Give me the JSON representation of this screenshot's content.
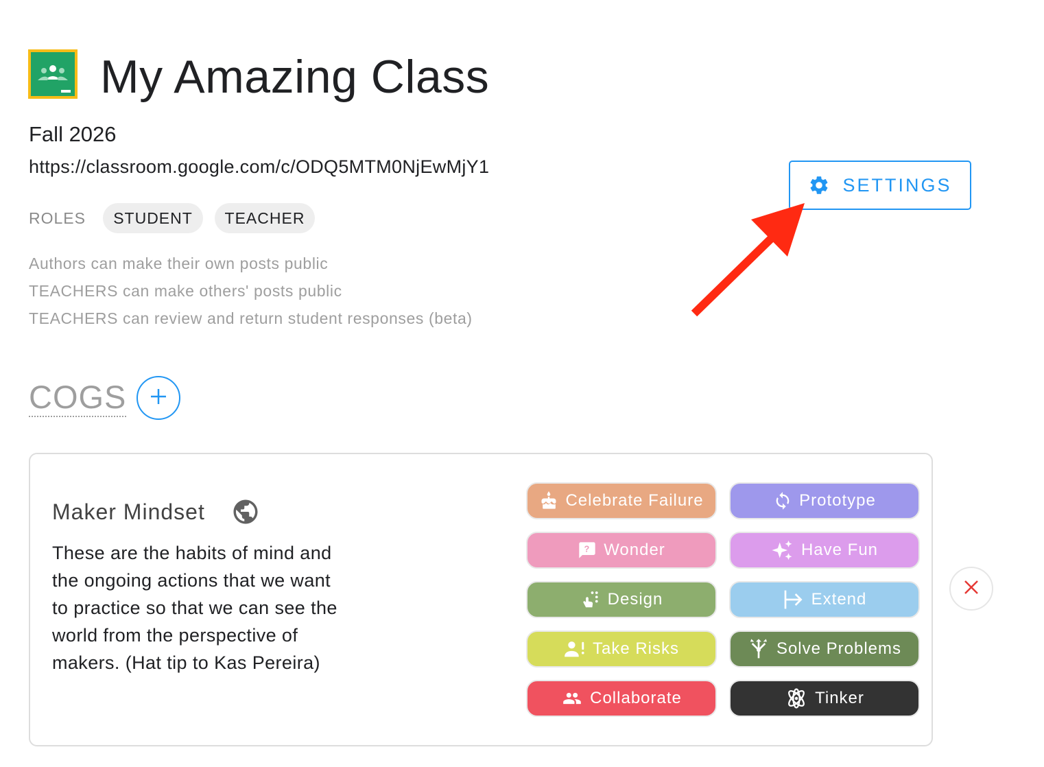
{
  "header": {
    "title": "My Amazing Class",
    "term": "Fall 2026",
    "url": "https://classroom.google.com/c/ODQ5MTM0NjEwMjY1",
    "logo_icon": "google-classroom-icon"
  },
  "roles": {
    "label": "ROLES",
    "items": [
      "STUDENT",
      "TEACHER"
    ]
  },
  "permissions": [
    "Authors can make their own posts public",
    "TEACHERS can make others' posts public",
    "TEACHERS can review and return student responses (beta)"
  ],
  "settings_button": {
    "label": "SETTINGS",
    "icon": "gear-icon",
    "color": "#2196f3"
  },
  "annotation": {
    "arrow_color": "#ff2a12"
  },
  "cogs": {
    "title": "COGS",
    "add_icon": "plus-icon",
    "card": {
      "title": "Maker Mindset",
      "visibility_icon": "globe-icon",
      "description": "These are the habits of mind and the ongoing actions that we want to practice so that we can see the world from the perspective of makers. (Hat tip to Kas Pereira)",
      "remove_icon": "close-icon",
      "tags": [
        {
          "label": "Celebrate Failure",
          "icon": "cake-icon",
          "color": "#e8a882"
        },
        {
          "label": "Prototype",
          "icon": "sync-icon",
          "color": "#9e98ec"
        },
        {
          "label": "Wonder",
          "icon": "question-bubble-icon",
          "color": "#ef9bbd"
        },
        {
          "label": "Have Fun",
          "icon": "sparkle-icon",
          "color": "#dc9cec"
        },
        {
          "label": "Design",
          "icon": "pointer-hand-icon",
          "color": "#8dae6e"
        },
        {
          "label": "Extend",
          "icon": "arrow-bar-right-icon",
          "color": "#9bcdee"
        },
        {
          "label": "Take Risks",
          "icon": "person-exclamation-icon",
          "color": "#d6dc5a"
        },
        {
          "label": "Solve Problems",
          "icon": "arrows-split-icon",
          "color": "#6d8a56"
        },
        {
          "label": "Collaborate",
          "icon": "people-icon",
          "color": "#f0525f"
        },
        {
          "label": "Tinker",
          "icon": "atom-icon",
          "color": "#333333"
        }
      ]
    }
  }
}
